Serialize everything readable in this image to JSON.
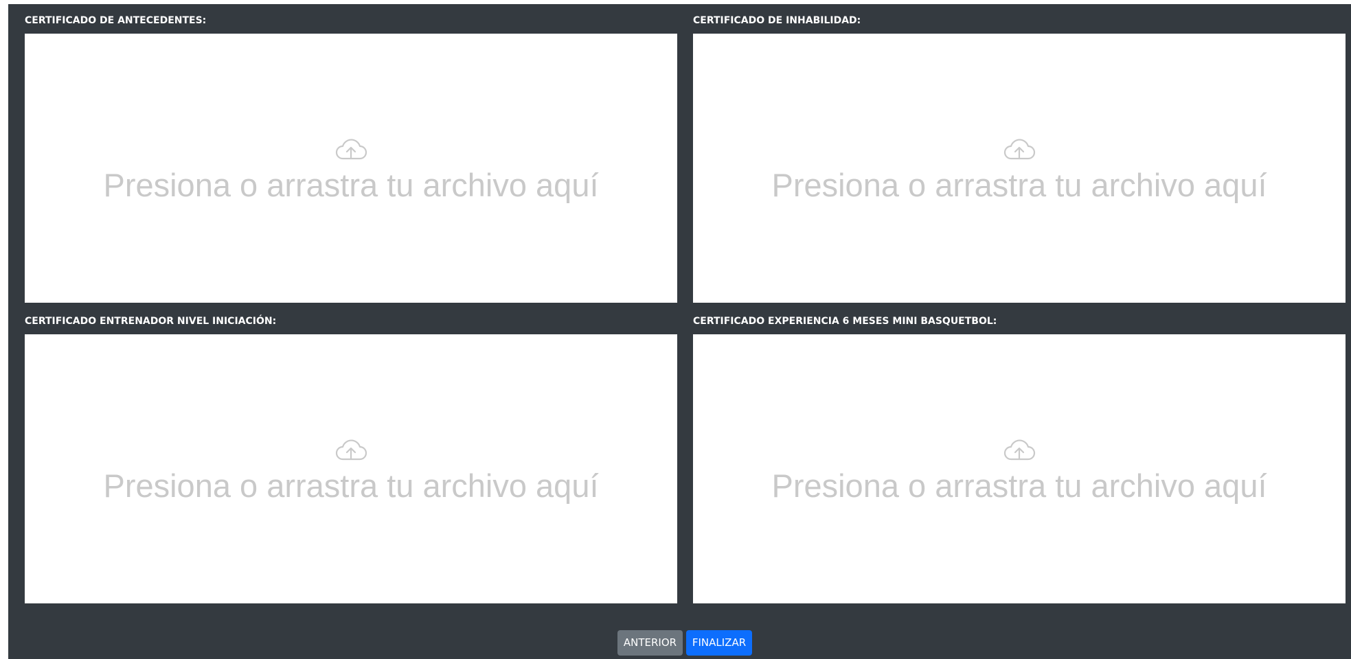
{
  "upload_fields": [
    {
      "label": "CERTIFICADO DE ANTECEDENTES:",
      "dropzone_text": "Presiona o arrastra tu archivo aquí",
      "icon": "cloud-upload-icon"
    },
    {
      "label": "CERTIFICADO DE INHABILIDAD:",
      "dropzone_text": "Presiona o arrastra tu archivo aquí",
      "icon": "cloud-upload-icon"
    },
    {
      "label": "CERTIFICADO ENTRENADOR NIVEL INICIACIÓN:",
      "dropzone_text": "Presiona o arrastra tu archivo aquí",
      "icon": "cloud-upload-icon"
    },
    {
      "label": "CERTIFICADO EXPERIENCIA 6 MESES MINI BASQUETBOL:",
      "dropzone_text": "Presiona o arrastra tu archivo aquí",
      "icon": "cloud-upload-icon"
    }
  ],
  "actions": {
    "previous_label": "ANTERIOR",
    "finish_label": "FINALIZAR"
  },
  "colors": {
    "panel_background": "#343a40",
    "previous_button": "#6c757d",
    "finish_button": "#0d6efd",
    "placeholder_text": "#c9c9c9"
  }
}
